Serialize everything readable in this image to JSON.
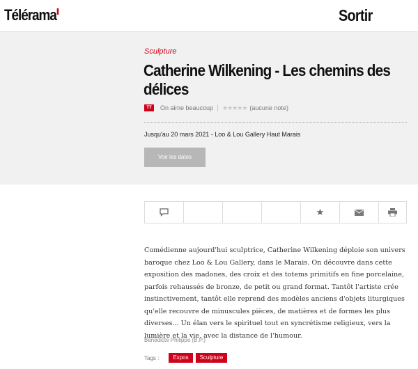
{
  "header": {
    "logo_text": "Télérama",
    "section_title": "Sortir"
  },
  "hero": {
    "category": "Sculpture",
    "title": "Catherine Wilkening - Les chemins des délices",
    "critic_label": "On aime beaucoup",
    "stars": "★★★★★",
    "rating_text": "(aucune note)",
    "dates_line": "Jusqu'au 20 mars 2021 - Loo & Lou Gallery Haut Marais",
    "dates_button": "Voir les dates"
  },
  "actions": {
    "star": "★"
  },
  "article": {
    "body": "Comédienne aujourd'hui sculptrice, Catherine Wilkening déploie son univers baroque chez Loo & Lou Gallery, dans le Marais. On découvre dans cette exposition des madones, des croix et des totems primitifs en fine porcelaine, parfois rehaussés de bronze, de petit ou grand format. Tantôt l'artiste crée instinctivement, tantôt elle reprend des modèles anciens d'objets liturgiques qu'elle recouvre de minuscules pièces, de matières et de formes les plus diverses... Un élan vers le spirituel tout en syncrétisme religieux, vers la lumière et la vie, avec la distance de l'humour.",
    "author": "Bénédicte Philippe (B.P.)",
    "tags_label": "Tags :",
    "tags": [
      "Expos",
      "Sculpture"
    ]
  },
  "colors": {
    "brand_red": "#d0021b",
    "hero_bg": "#f1f1f1"
  }
}
